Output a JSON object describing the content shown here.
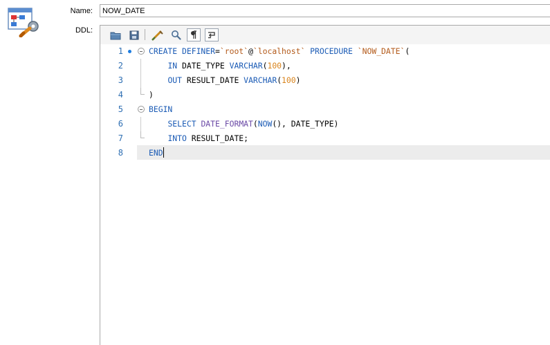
{
  "labels": {
    "name": "Name:",
    "ddl": "DDL:"
  },
  "name_value": "NOW_DATE",
  "toolbar": [
    {
      "name": "open-icon"
    },
    {
      "name": "save-icon"
    },
    {
      "name": "beautify-icon"
    },
    {
      "name": "find-icon"
    },
    {
      "name": "show-whitespace-icon"
    },
    {
      "name": "word-wrap-icon"
    }
  ],
  "lines": [
    {
      "n": "1",
      "bookmark": true,
      "fold": "open",
      "segs": [
        [
          "kw",
          "CREATE DEFINER"
        ],
        [
          "",
          "="
        ],
        [
          "str",
          "`root`"
        ],
        [
          "",
          "@"
        ],
        [
          "str",
          "`localhost`"
        ],
        [
          "",
          ""
        ],
        [
          "kw",
          " PROCEDURE "
        ],
        [
          "str",
          "`NOW_DATE`"
        ],
        [
          "",
          "("
        ]
      ]
    },
    {
      "n": "2",
      "segs": [
        [
          "",
          "    "
        ],
        [
          "kw",
          "IN"
        ],
        [
          "",
          " DATE_TYPE "
        ],
        [
          "kw",
          "VARCHAR"
        ],
        [
          "",
          "("
        ],
        [
          "num",
          "100"
        ],
        [
          "",
          "),"
        ]
      ]
    },
    {
      "n": "3",
      "segs": [
        [
          "",
          "    "
        ],
        [
          "kw",
          "OUT"
        ],
        [
          "",
          " RESULT_DATE "
        ],
        [
          "kw",
          "VARCHAR"
        ],
        [
          "",
          "("
        ],
        [
          "num",
          "100"
        ],
        [
          "",
          ")"
        ]
      ]
    },
    {
      "n": "4",
      "fold": "end",
      "segs": [
        [
          "",
          ")"
        ]
      ]
    },
    {
      "n": "5",
      "fold": "open",
      "segs": [
        [
          "kw",
          "BEGIN"
        ]
      ]
    },
    {
      "n": "6",
      "segs": [
        [
          "",
          "    "
        ],
        [
          "kw",
          "SELECT"
        ],
        [
          "",
          " "
        ],
        [
          "fn",
          "DATE_FORMAT"
        ],
        [
          "",
          "("
        ],
        [
          "kw",
          "NOW"
        ],
        [
          "",
          "(), DATE_TYPE)"
        ]
      ]
    },
    {
      "n": "7",
      "fold": "end",
      "segs": [
        [
          "",
          "    "
        ],
        [
          "kw",
          "INTO"
        ],
        [
          "",
          " RESULT_DATE;"
        ]
      ]
    },
    {
      "n": "8",
      "current": true,
      "segs": [
        [
          "kw",
          "END"
        ]
      ]
    }
  ]
}
